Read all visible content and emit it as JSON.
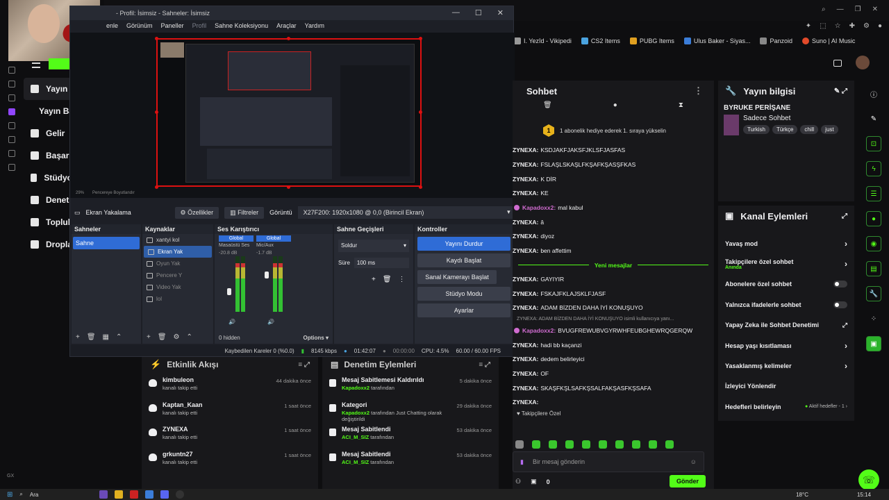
{
  "webcam": {
    "label": "webcam-overlay"
  },
  "bookmarks": [
    "I. Yezîd - Vikipedi",
    "CS2 Items",
    "PUBG Items",
    "Ulus Baker - Siyas...",
    "Panzoid",
    "Suno | AI Music"
  ],
  "sidenav": {
    "items": [
      {
        "label": "Yayın",
        "icon": "broadcast-icon"
      },
      {
        "label": "Yayın Ba",
        "icon": ""
      },
      {
        "label": "Gelir",
        "icon": "chart-icon"
      },
      {
        "label": "Başarı",
        "icon": "trophy-icon"
      },
      {
        "label": "Stüdyo",
        "icon": "studio-icon"
      },
      {
        "label": "Deneti",
        "icon": "wrench-icon"
      },
      {
        "label": "Toplul",
        "icon": "book-icon"
      },
      {
        "label": "Dropla",
        "icon": "drops-icon"
      }
    ]
  },
  "obs": {
    "title": "- Profil: İsimsiz - Sahneler: İsimsiz",
    "menu": [
      "enle",
      "Görünüm",
      "Paneller",
      "Profil",
      "Sahne Koleksiyonu",
      "Araçlar",
      "Yardım"
    ],
    "preview": {
      "zoom": "29%",
      "fit_label": "Pencereye Boyutlandır"
    },
    "source_bar": {
      "source_name": "Ekran Yakalama",
      "properties": "Özellikler",
      "filters": "Filtreler",
      "display_label": "Görüntü",
      "display_value": "X27F200: 1920x1080 @ 0,0 (Birincil Ekran)"
    },
    "scenes": {
      "title": "Sahneler",
      "items": [
        "Sahne"
      ]
    },
    "sources": {
      "title": "Kaynaklar",
      "items": [
        "xantyi kol",
        "Ekran Yak",
        "Oyun Yak",
        "Pencere Y",
        "Video Yak",
        "lol"
      ]
    },
    "mixer": {
      "title": "Ses Karıştırıcı",
      "channels": [
        {
          "scope": "Global",
          "name": "Masaüstü Ses",
          "db": "-20.8 dB",
          "level": 0.6
        },
        {
          "scope": "Global",
          "name": "Mic/Aux",
          "db": "-1.7 dB",
          "level": 0.8
        }
      ],
      "hidden": "0 hidden",
      "options": "Options"
    },
    "transitions": {
      "title": "Sahne Geçişleri",
      "type": "Soldur",
      "duration_label": "Süre",
      "duration": "100 ms"
    },
    "controls": {
      "title": "Kontroller",
      "buttons": [
        "Yayını Durdur",
        "Kaydı Başlat",
        "Sanal Kamerayı Başlat",
        "Stüdyo Modu",
        "Ayarlar"
      ]
    },
    "status": {
      "dropped": "Kaybedilen Kareler 0 (%0.0)",
      "bitrate": "8145 kbps",
      "live_time": "01:42:07",
      "rec_time": "00:00:00",
      "cpu": "CPU: 4.5%",
      "fps": "60.00 / 60.00 FPS"
    }
  },
  "chat": {
    "title": "Sohbet",
    "gift": {
      "badge": "1",
      "text": "1 abonelik hediye ederek 1. sıraya yükselin"
    },
    "messages": [
      {
        "user": "ZYNEXA:",
        "text": "KSDJAKFJAKSFJKLSFJASFAS",
        "kind": "z"
      },
      {
        "user": "ZYNEXA:",
        "text": "FSLAŞLSKAŞLFKŞAFKŞASŞFKAS",
        "kind": "z"
      },
      {
        "user": "ZYNEXA:",
        "text": "K DİR",
        "kind": "z"
      },
      {
        "user": "ZYNEXA:",
        "text": "KE",
        "kind": "z"
      },
      {
        "user": "Kapadoxx2:",
        "text": "mal kabul",
        "kind": "k"
      },
      {
        "user": "ZYNEXA:",
        "text": "â",
        "kind": "z"
      },
      {
        "user": "ZYNEXA:",
        "text": "diyoz",
        "kind": "z"
      },
      {
        "user": "ZYNEXA:",
        "text": "ben affettim",
        "kind": "z"
      }
    ],
    "new_label": "Yeni mesajlar",
    "messages2": [
      {
        "user": "ZYNEXA:",
        "text": "GAYIYIR",
        "kind": "z"
      },
      {
        "user": "ZYNEXA:",
        "text": "FSKAJFKLAJSKLFJASF",
        "kind": "z"
      },
      {
        "user": "ZYNEXA:",
        "text": "ADAM BİZDEN DAHA İYİ KONUŞUYO",
        "kind": "z"
      }
    ],
    "system": "ZYNEXA: ADAM BİZDEN DAHA İYİ KONUŞUYO isimli kullanıcıya yanı...",
    "messages3": [
      {
        "user": "Kapadoxx2:",
        "text": "BVUGFREWUBVGYRWHFEUBGHEWRQGERQW",
        "kind": "k"
      },
      {
        "user": "ZYNEXA:",
        "text": "hadi bb kaçanzi",
        "kind": "z"
      },
      {
        "user": "ZYNEXA:",
        "text": "dedem belirleyici",
        "kind": "z"
      },
      {
        "user": "ZYNEXA:",
        "text": "OF",
        "kind": "z"
      },
      {
        "user": "ZYNEXA:",
        "text": "SKAŞFKŞLSAFKŞSALFAKŞASFKŞSAFA",
        "kind": "z"
      },
      {
        "user": "ZYNEXA:",
        "text": "",
        "kind": "z"
      }
    ],
    "follower_label": "♥ Takipçilere Özel",
    "input_placeholder": "Bir mesaj gönderin",
    "count": "0",
    "send": "Gönder"
  },
  "stream_info": {
    "title": "Yayın bilgisi",
    "stream_title": "BYRUKE PERİŞANE",
    "category": "Sadece Sohbet",
    "tags": [
      "Turkish",
      "Türkçe",
      "chill",
      "just"
    ]
  },
  "channel_actions": {
    "title": "Kanal Eylemleri",
    "items": [
      {
        "label": "Yavaş mod",
        "sub": "",
        "kind": "arrow"
      },
      {
        "label": "Takipçilere özel sohbet",
        "sub": "Anında",
        "kind": "arrow"
      },
      {
        "label": "Abonelere özel sohbet",
        "sub": "",
        "kind": "toggle"
      },
      {
        "label": "Yalnızca ifadelerle sohbet",
        "sub": "",
        "kind": "toggle"
      },
      {
        "label": "Yapay Zeka ile Sohbet Denetimi",
        "sub": "",
        "kind": "ext"
      },
      {
        "label": "Hesap yaşı kısıtlaması",
        "sub": "",
        "kind": "arrow"
      },
      {
        "label": "Yasaklanmış kelimeler",
        "sub": "",
        "kind": "arrow"
      },
      {
        "label": "İzleyici Yönlendir",
        "sub": "",
        "kind": "none"
      },
      {
        "label": "Hedefleri belirleyin",
        "sub": "",
        "kind": "goal"
      }
    ],
    "goal_text": "Aktif hedefler - 1"
  },
  "activity": {
    "title": "Etkinlik Akışı",
    "items": [
      {
        "name": "kimbuleon",
        "sub": "kanalı takip etti",
        "time": "44 dakika önce"
      },
      {
        "name": "Kaptan_Kaan",
        "sub": "kanalı takip etti",
        "time": "1 saat önce"
      },
      {
        "name": "ZYNEXA",
        "sub": "kanalı takip etti",
        "time": "1 saat önce"
      },
      {
        "name": "grkuntn27",
        "sub": "kanalı takip etti",
        "time": "1 saat önce"
      }
    ]
  },
  "moderation": {
    "title": "Denetim Eylemleri",
    "items": [
      {
        "name": "Mesaj Sabitlemesi Kaldırıldı",
        "user": "Kapadoxx2",
        "sub": " tarafından",
        "time": "5 dakika önce"
      },
      {
        "name": "Kategori",
        "user": "Kapadoxx2",
        "sub": " tarafından Just Chatting olarak değiştirildi",
        "time": "29 dakika önce"
      },
      {
        "name": "Mesaj Sabitlendi",
        "user": "ACI_M_SIZ",
        "sub": " tarafından",
        "time": "53 dakika önce"
      },
      {
        "name": "Mesaj Sabitlendi",
        "user": "ACI_M_SIZ",
        "sub": " tarafından",
        "time": "53 dakika önce"
      }
    ]
  },
  "taskbar": {
    "search": "Ara",
    "weather": "18°C",
    "time": "15:14"
  },
  "colors": {
    "accent": "#53fc18",
    "obs_blue": "#2f6cd6",
    "live_red": "#dd1111"
  }
}
